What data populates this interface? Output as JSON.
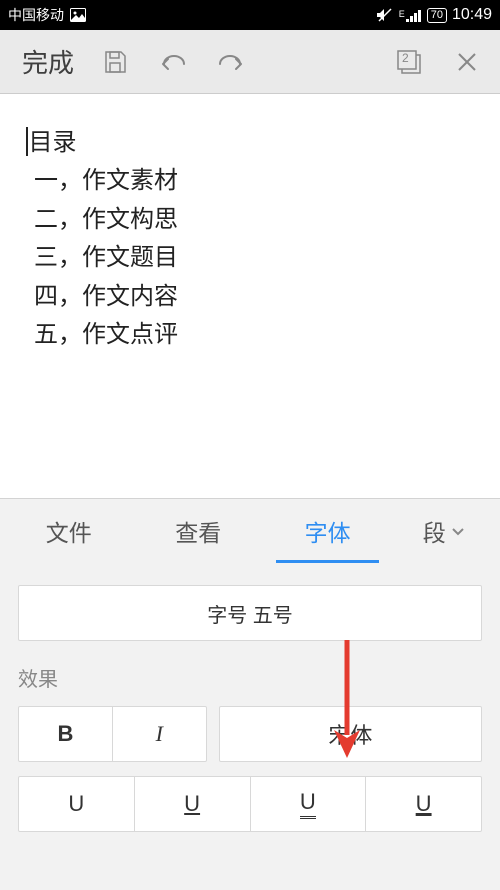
{
  "status": {
    "carrier": "中国移动",
    "battery": "70",
    "time": "10:49",
    "network": "E"
  },
  "toolbar": {
    "done": "完成",
    "pages": "2"
  },
  "document": {
    "lines": [
      "目录",
      "一，作文素材",
      "二，作文构思",
      "三，作文题目",
      "四，作文内容",
      "五，作文点评"
    ]
  },
  "tabs": {
    "file": "文件",
    "view": "查看",
    "font": "字体",
    "paragraph": "段"
  },
  "font_panel": {
    "size_label": "字号 五号",
    "effects_label": "效果",
    "bold": "B",
    "italic": "I",
    "font_name": "宋体",
    "u_plain": "U",
    "u_single": "U",
    "u_double": "U",
    "u_wavy": "U"
  }
}
